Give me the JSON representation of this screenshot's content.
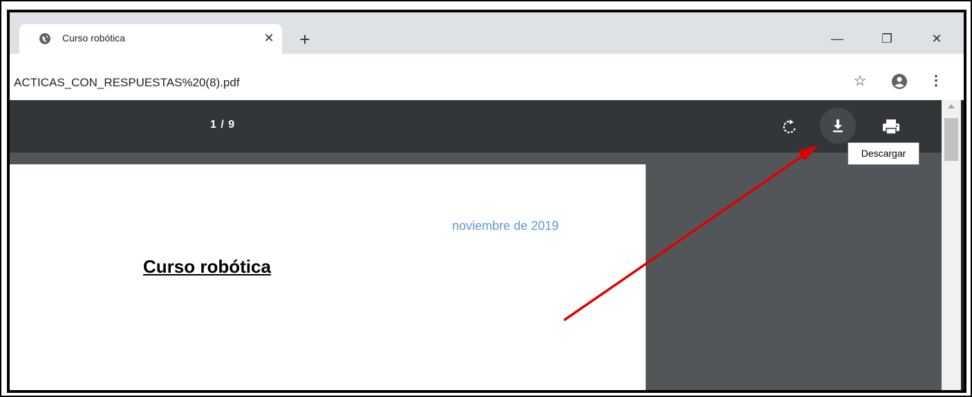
{
  "tab": {
    "title": "Curso robótica",
    "close_glyph": "✕",
    "favicon": "globe-icon"
  },
  "new_tab_glyph": "+",
  "window_controls": {
    "minimize": "—",
    "restore": "❐",
    "close": "✕"
  },
  "address_bar": {
    "url": "ACTICAS_CON_RESPUESTAS%20(8).pdf"
  },
  "toolbar_icons": {
    "bookmark": "☆",
    "menu": "⋮"
  },
  "pdf_toolbar": {
    "page_indicator": "1 / 9",
    "download_tooltip": "Descargar"
  },
  "document": {
    "date": "noviembre de 2019",
    "title": "Curso robótica"
  },
  "colors": {
    "pdf_toolbar_bg": "#323639",
    "viewer_bg": "#525659",
    "date_text": "#5b9bd5",
    "annotation_arrow": "#e00000"
  }
}
